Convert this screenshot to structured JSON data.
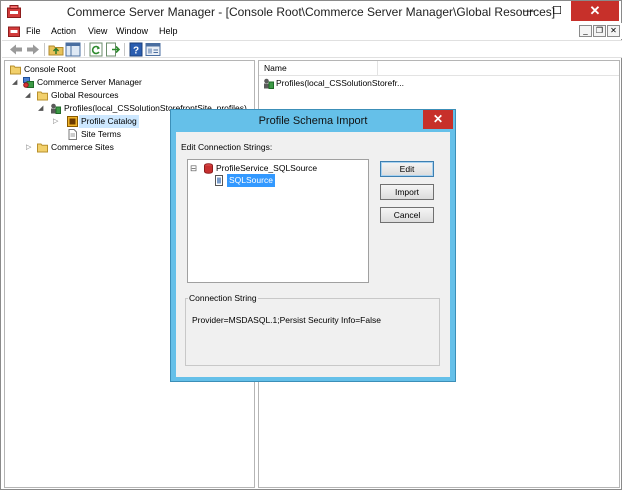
{
  "window": {
    "title": "Commerce Server Manager - [Console Root\\Commerce Server Manager\\Global Resources]",
    "caption_buttons": {
      "minimize": "—",
      "maximize": "☐",
      "close": "✕"
    }
  },
  "menubar": {
    "items": [
      "File",
      "Action",
      "View",
      "Window",
      "Help"
    ],
    "mdi_buttons": {
      "minimize": "_",
      "restore": "❐",
      "close": "✕"
    }
  },
  "toolbar": {
    "icons": [
      "back-arrow-icon",
      "forward-arrow-icon",
      "up-folder-icon",
      "show-hide-tree-icon",
      "refresh-icon",
      "export-list-icon",
      "help-icon",
      "properties-icon"
    ]
  },
  "tree": {
    "items": [
      {
        "label": "Console Root",
        "icon": "folder-icon"
      },
      {
        "label": "Commerce Server Manager",
        "icon": "server-manager-icon"
      },
      {
        "label": "Global Resources",
        "icon": "folder-icon"
      },
      {
        "label": "Profiles(local_CSSolutionStorefrontSite_profiles)",
        "icon": "profiles-icon"
      },
      {
        "label": "Profile Catalog",
        "icon": "catalog-icon"
      },
      {
        "label": "Site Terms",
        "icon": "document-icon"
      },
      {
        "label": "Commerce Sites",
        "icon": "folder-icon"
      }
    ]
  },
  "list": {
    "column_name": "Name",
    "rows": [
      "Profiles(local_CSSolutionStorefr..."
    ]
  },
  "dialog": {
    "title": "Profile Schema Import",
    "close": "✕",
    "caption": "Edit Connection Strings:",
    "tree": {
      "expander": "⊟",
      "root_label": "ProfileService_SQLSource",
      "child_label": "SQLSource"
    },
    "buttons": {
      "edit": "Edit",
      "import": "Import",
      "cancel": "Cancel"
    },
    "connection_string_label": "Connection String",
    "connection_string_value": "Provider=MSDASQL.1;Persist Security Info=False"
  },
  "colors": {
    "dialog_frame": "#65c0e9",
    "close_button": "#c7302a",
    "selection": "#3399ff",
    "tree_selection": "#cde8ff"
  }
}
